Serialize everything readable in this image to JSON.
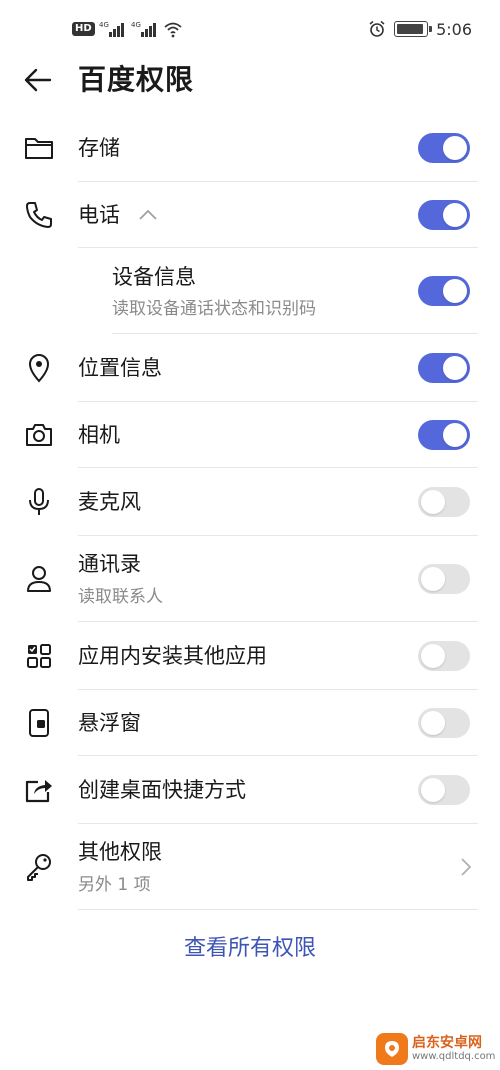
{
  "status": {
    "left_badge": "HD",
    "signal1": "4G",
    "signal2": "4G",
    "time": "5:06"
  },
  "header": {
    "title": "百度权限"
  },
  "permissions": [
    {
      "label": "存储",
      "sub": "",
      "on": true,
      "icon": "folder-icon"
    },
    {
      "label": "电话",
      "sub": "",
      "on": true,
      "icon": "phone-icon",
      "expanded": true
    },
    {
      "label": "设备信息",
      "sub": "读取设备通话状态和识别码",
      "on": true,
      "icon": ""
    },
    {
      "label": "位置信息",
      "sub": "",
      "on": true,
      "icon": "location-pin-icon"
    },
    {
      "label": "相机",
      "sub": "",
      "on": true,
      "icon": "camera-icon"
    },
    {
      "label": "麦克风",
      "sub": "",
      "on": false,
      "icon": "microphone-icon"
    },
    {
      "label": "通讯录",
      "sub": "读取联系人",
      "on": false,
      "icon": "contacts-person-icon"
    },
    {
      "label": "应用内安装其他应用",
      "sub": "",
      "on": false,
      "icon": "apps-grid-icon"
    },
    {
      "label": "悬浮窗",
      "sub": "",
      "on": false,
      "icon": "floating-window-icon"
    },
    {
      "label": "创建桌面快捷方式",
      "sub": "",
      "on": false,
      "icon": "shortcut-share-icon"
    },
    {
      "label": "其他权限",
      "sub": "另外 1 项",
      "icon": "key-icon"
    }
  ],
  "footer": {
    "view_all": "查看所有权限"
  },
  "watermark": {
    "name": "启东安卓网",
    "url": "www.qdltdq.com"
  },
  "colors": {
    "accent": "#5468db",
    "link": "#3d55b6",
    "toggle_off": "#e3e3e3"
  }
}
